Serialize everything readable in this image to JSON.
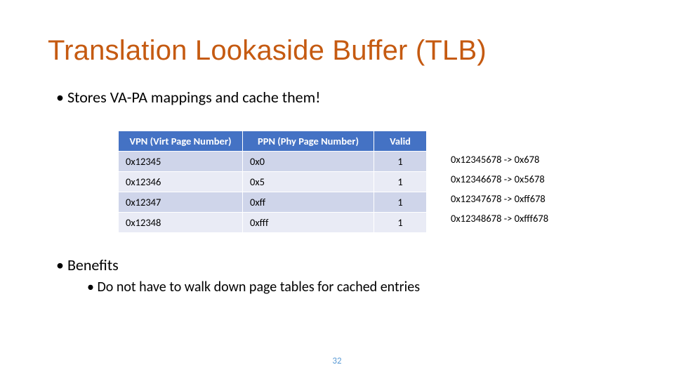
{
  "title": "Translation Lookaside Buffer (TLB)",
  "bullet1": "Stores VA-PA mappings and cache them!",
  "table": {
    "headers": {
      "vpn": "VPN (Virt Page Number)",
      "ppn": "PPN (Phy Page Number)",
      "valid": "Valid"
    },
    "rows": [
      {
        "vpn": "0x12345",
        "ppn": "0x0",
        "valid": "1"
      },
      {
        "vpn": "0x12346",
        "ppn": "0x5",
        "valid": "1"
      },
      {
        "vpn": "0x12347",
        "ppn": "0xff",
        "valid": "1"
      },
      {
        "vpn": "0x12348",
        "ppn": "0xfff",
        "valid": "1"
      }
    ]
  },
  "mappings": [
    "0x12345678 -> 0x678",
    "0x12346678 -> 0x5678",
    "0x12347678 -> 0xff678",
    "0x12348678 -> 0xfff678"
  ],
  "benefits_label": "Benefits",
  "benefit1": "Do not have to walk down page tables for cached entries",
  "page_number": "32"
}
